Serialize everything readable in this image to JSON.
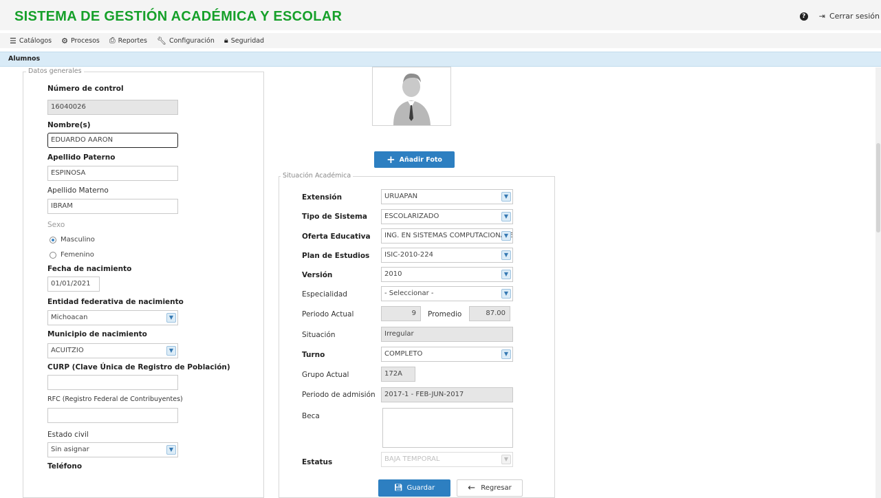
{
  "header": {
    "title": "SISTEMA DE GESTIÓN ACADÉMICA Y ESCOLAR",
    "help_icon": "question-circle-icon",
    "logout_label": "Cerrar sesión"
  },
  "menu": [
    {
      "icon": "list-icon",
      "label": "Catálogos"
    },
    {
      "icon": "gear-icon",
      "label": "Procesos"
    },
    {
      "icon": "print-icon",
      "label": "Reportes"
    },
    {
      "icon": "wrench-icon",
      "label": "Configuración"
    },
    {
      "icon": "lock-icon",
      "label": "Seguridad"
    }
  ],
  "breadcrumb": "Alumnos",
  "general": {
    "legend": "Datos generales",
    "control_label": "Número de control",
    "control_value": "16040026",
    "nombre_label": "Nombre(s)",
    "nombre_value": "EDUARDO AARON",
    "paterno_label": "Apellido Paterno",
    "paterno_value": "ESPINOSA",
    "materno_label": "Apellido Materno",
    "materno_value": "IBRAM",
    "sexo_label": "Sexo",
    "sexo_options": [
      "Masculino",
      "Femenino"
    ],
    "sexo_selected": "Masculino",
    "fecha_label": "Fecha de nacimiento",
    "fecha_value": "01/01/2021",
    "entidad_label": "Entidad federativa de nacimiento",
    "entidad_value": "Michoacan",
    "municipio_label": "Municipio de nacimiento",
    "municipio_value": "ACUITZIO",
    "curp_label": "CURP (Clave Única de Registro de Población)",
    "curp_value": "",
    "rfc_label": "RFC (Registro Federal de Contribuyentes)",
    "rfc_value": "",
    "civil_label": "Estado civil",
    "civil_value": "Sin asignar",
    "telefono_label": "Teléfono"
  },
  "photo": {
    "icon": "user-avatar-icon",
    "add_label": "Añadir Foto"
  },
  "academic": {
    "legend": "Situación Académica",
    "extension_label": "Extensión",
    "extension_value": "URUAPAN",
    "tipo_label": "Tipo de Sistema",
    "tipo_value": "ESCOLARIZADO",
    "oferta_label": "Oferta Educativa",
    "oferta_value": "ING. EN SISTEMAS COMPUTACIONALES",
    "plan_label": "Plan de Estudios",
    "plan_value": "ISIC-2010-224",
    "version_label": "Versión",
    "version_value": "2010",
    "especialidad_label": "Especialidad",
    "especialidad_value": "- Seleccionar -",
    "periodo_label": "Periodo Actual",
    "periodo_value": "9",
    "promedio_label": "Promedio",
    "promedio_value": "87.00",
    "situacion_label": "Situación",
    "situacion_value": "Irregular",
    "turno_label": "Turno",
    "turno_value": "COMPLETO",
    "grupo_label": "Grupo Actual",
    "grupo_value": "172A",
    "admision_label": "Periodo de admisión",
    "admision_value": "2017-1 - FEB-JUN-2017",
    "beca_label": "Beca",
    "beca_value": "",
    "estatus_label": "Estatus",
    "estatus_value": "BAJA TEMPORAL"
  },
  "actions": {
    "save_label": "Guardar",
    "back_label": "Regresar"
  },
  "colors": {
    "title_green": "#16a02a",
    "primary_blue": "#2d7fc1",
    "crumb_bg": "#d9ebf7"
  }
}
